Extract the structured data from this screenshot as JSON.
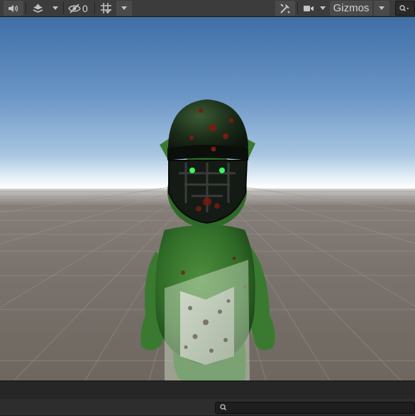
{
  "toolbar": {
    "hidden_count": "0",
    "gizmos_label": "Gizmos",
    "icons": [
      "audio-icon",
      "effects-icon",
      "visibility-off-icon",
      "grid-icon",
      "tools-icon",
      "camera-icon",
      "search-icon"
    ]
  },
  "scene": {
    "description_colors": {
      "sky_top": "#3f6fa7",
      "horizon": "#ffffff",
      "ground": "#7a726c",
      "character_body": "#3e7a33",
      "helmet": "#1e2c1c",
      "eyes": "#34ff5a"
    }
  },
  "bottom": {
    "search_placeholder": ""
  }
}
